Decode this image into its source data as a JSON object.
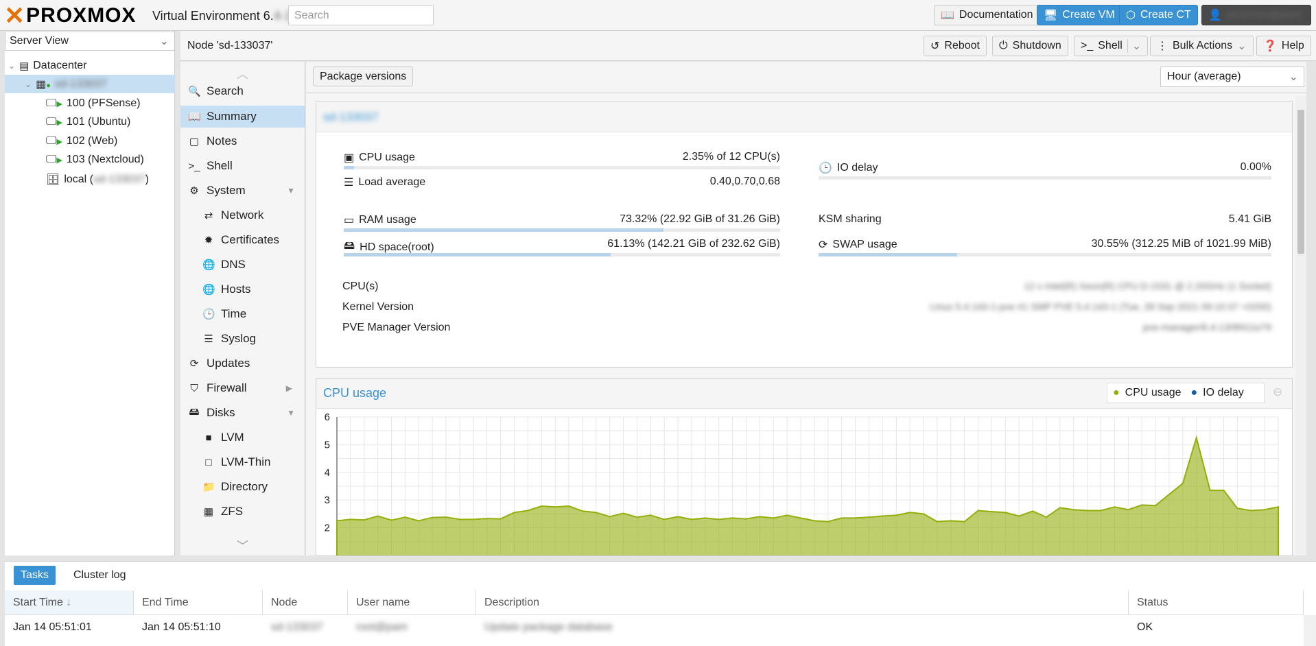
{
  "header": {
    "logo_text": "PROXMOX",
    "product": "Virtual Environment 6.",
    "version_blurred": "4-13",
    "search_placeholder": "Search",
    "documentation": "Documentation",
    "create_vm": "Create VM",
    "create_ct": "Create CT",
    "user": "proxmox@pam"
  },
  "tree": {
    "view": "Server View",
    "datacenter": "Datacenter",
    "node": "sd-133037",
    "items": [
      {
        "label": "100 (PFSense)"
      },
      {
        "label": "101 (Ubuntu)"
      },
      {
        "label": "102 (Web)"
      },
      {
        "label": "103 (Nextcloud)"
      }
    ],
    "storage_label": "local (",
    "storage_node": "sd-133037",
    "storage_close": ")"
  },
  "node_bar": {
    "title": "Node 'sd-133037'",
    "reboot": "Reboot",
    "shutdown": "Shutdown",
    "shell": "Shell",
    "bulk": "Bulk Actions",
    "help": "Help"
  },
  "menu": [
    {
      "label": "Search",
      "icon": "search-icon"
    },
    {
      "label": "Summary",
      "icon": "book-icon"
    },
    {
      "label": "Notes",
      "icon": "note-icon"
    },
    {
      "label": "Shell",
      "icon": "terminal-icon"
    },
    {
      "label": "System",
      "icon": "gears-icon"
    },
    {
      "label": "Network",
      "icon": "exchange-icon"
    },
    {
      "label": "Certificates",
      "icon": "certificate-icon"
    },
    {
      "label": "DNS",
      "icon": "globe-icon"
    },
    {
      "label": "Hosts",
      "icon": "globe-icon"
    },
    {
      "label": "Time",
      "icon": "clock-icon"
    },
    {
      "label": "Syslog",
      "icon": "list-icon"
    },
    {
      "label": "Updates",
      "icon": "refresh-icon"
    },
    {
      "label": "Firewall",
      "icon": "shield-icon"
    },
    {
      "label": "Disks",
      "icon": "hdd-icon"
    },
    {
      "label": "LVM",
      "icon": "square-icon"
    },
    {
      "label": "LVM-Thin",
      "icon": "square-outline-icon"
    },
    {
      "label": "Directory",
      "icon": "folder-icon"
    },
    {
      "label": "ZFS",
      "icon": "grid-icon"
    }
  ],
  "summary": {
    "package_versions": "Package versions",
    "timeframe": "Hour (average)",
    "node_title": "sd-133037",
    "cpu_label": "CPU usage",
    "cpu_value": "2.35% of 12 CPU(s)",
    "cpu_pct": 2.35,
    "load_label": "Load average",
    "load_value": "0.40,0.70,0.68",
    "io_label": "IO delay",
    "io_value": "0.00%",
    "io_pct": 0,
    "ram_label": "RAM usage",
    "ram_value": "73.32% (22.92 GiB of 31.26 GiB)",
    "ram_pct": 73.32,
    "hd_label": "HD space(root)",
    "hd_value": "61.13% (142.21 GiB of 232.62 GiB)",
    "hd_pct": 61.13,
    "ksm_label": "KSM sharing",
    "ksm_value": "5.41 GiB",
    "swap_label": "SWAP usage",
    "swap_value": "30.55% (312.25 MiB of 1021.99 MiB)",
    "swap_pct": 30.55,
    "cpus_label": "CPU(s)",
    "cpus_value": "12 x Intel(R) Xeon(R) CPU D-1531 @ 2.20GHz (1 Socket)",
    "kernel_label": "Kernel Version",
    "kernel_value": "Linux 5.4.143-1-pve #1 SMP PVE 5.4.143-1 (Tue, 28 Sep 2021 09:10:37 +0200)",
    "pve_label": "PVE Manager Version",
    "pve_value": "pve-manager/6.4-13/9f411e79"
  },
  "chart_panel": {
    "title": "CPU usage",
    "legend_cpu": "CPU usage",
    "legend_io": "IO delay",
    "colors": {
      "cpu": "#94ae0a",
      "io": "#115fa6"
    }
  },
  "chart_data": {
    "type": "area",
    "title": "CPU usage",
    "ylim": [
      1.5,
      6
    ],
    "yticks": [
      2,
      3,
      4,
      5,
      6
    ],
    "series": [
      {
        "name": "CPU usage",
        "values": [
          2.25,
          2.3,
          2.28,
          2.42,
          2.27,
          2.38,
          2.25,
          2.37,
          2.38,
          2.3,
          2.3,
          2.33,
          2.32,
          2.55,
          2.62,
          2.78,
          2.75,
          2.78,
          2.6,
          2.55,
          2.4,
          2.52,
          2.38,
          2.45,
          2.3,
          2.4,
          2.3,
          2.35,
          2.3,
          2.35,
          2.32,
          2.4,
          2.35,
          2.45,
          2.35,
          2.25,
          2.22,
          2.35,
          2.35,
          2.38,
          2.42,
          2.45,
          2.55,
          2.5,
          2.22,
          2.25,
          2.22,
          2.62,
          2.58,
          2.55,
          2.42,
          2.6,
          2.38,
          2.72,
          2.65,
          2.62,
          2.62,
          2.75,
          2.65,
          2.82,
          2.8,
          3.2,
          3.6,
          5.25,
          3.35,
          3.35,
          2.7,
          2.62,
          2.65,
          2.75
        ]
      },
      {
        "name": "IO delay",
        "values": []
      }
    ]
  },
  "bottom": {
    "tab_tasks": "Tasks",
    "tab_cluster": "Cluster log",
    "columns": [
      "Start Time",
      "End Time",
      "Node",
      "User name",
      "Description",
      "Status"
    ],
    "row": {
      "start": "Jan 14 05:51:01",
      "end": "Jan 14 05:51:10",
      "node": "sd-133037",
      "user": "root@pam",
      "description": "Update package database",
      "status": "OK"
    }
  }
}
